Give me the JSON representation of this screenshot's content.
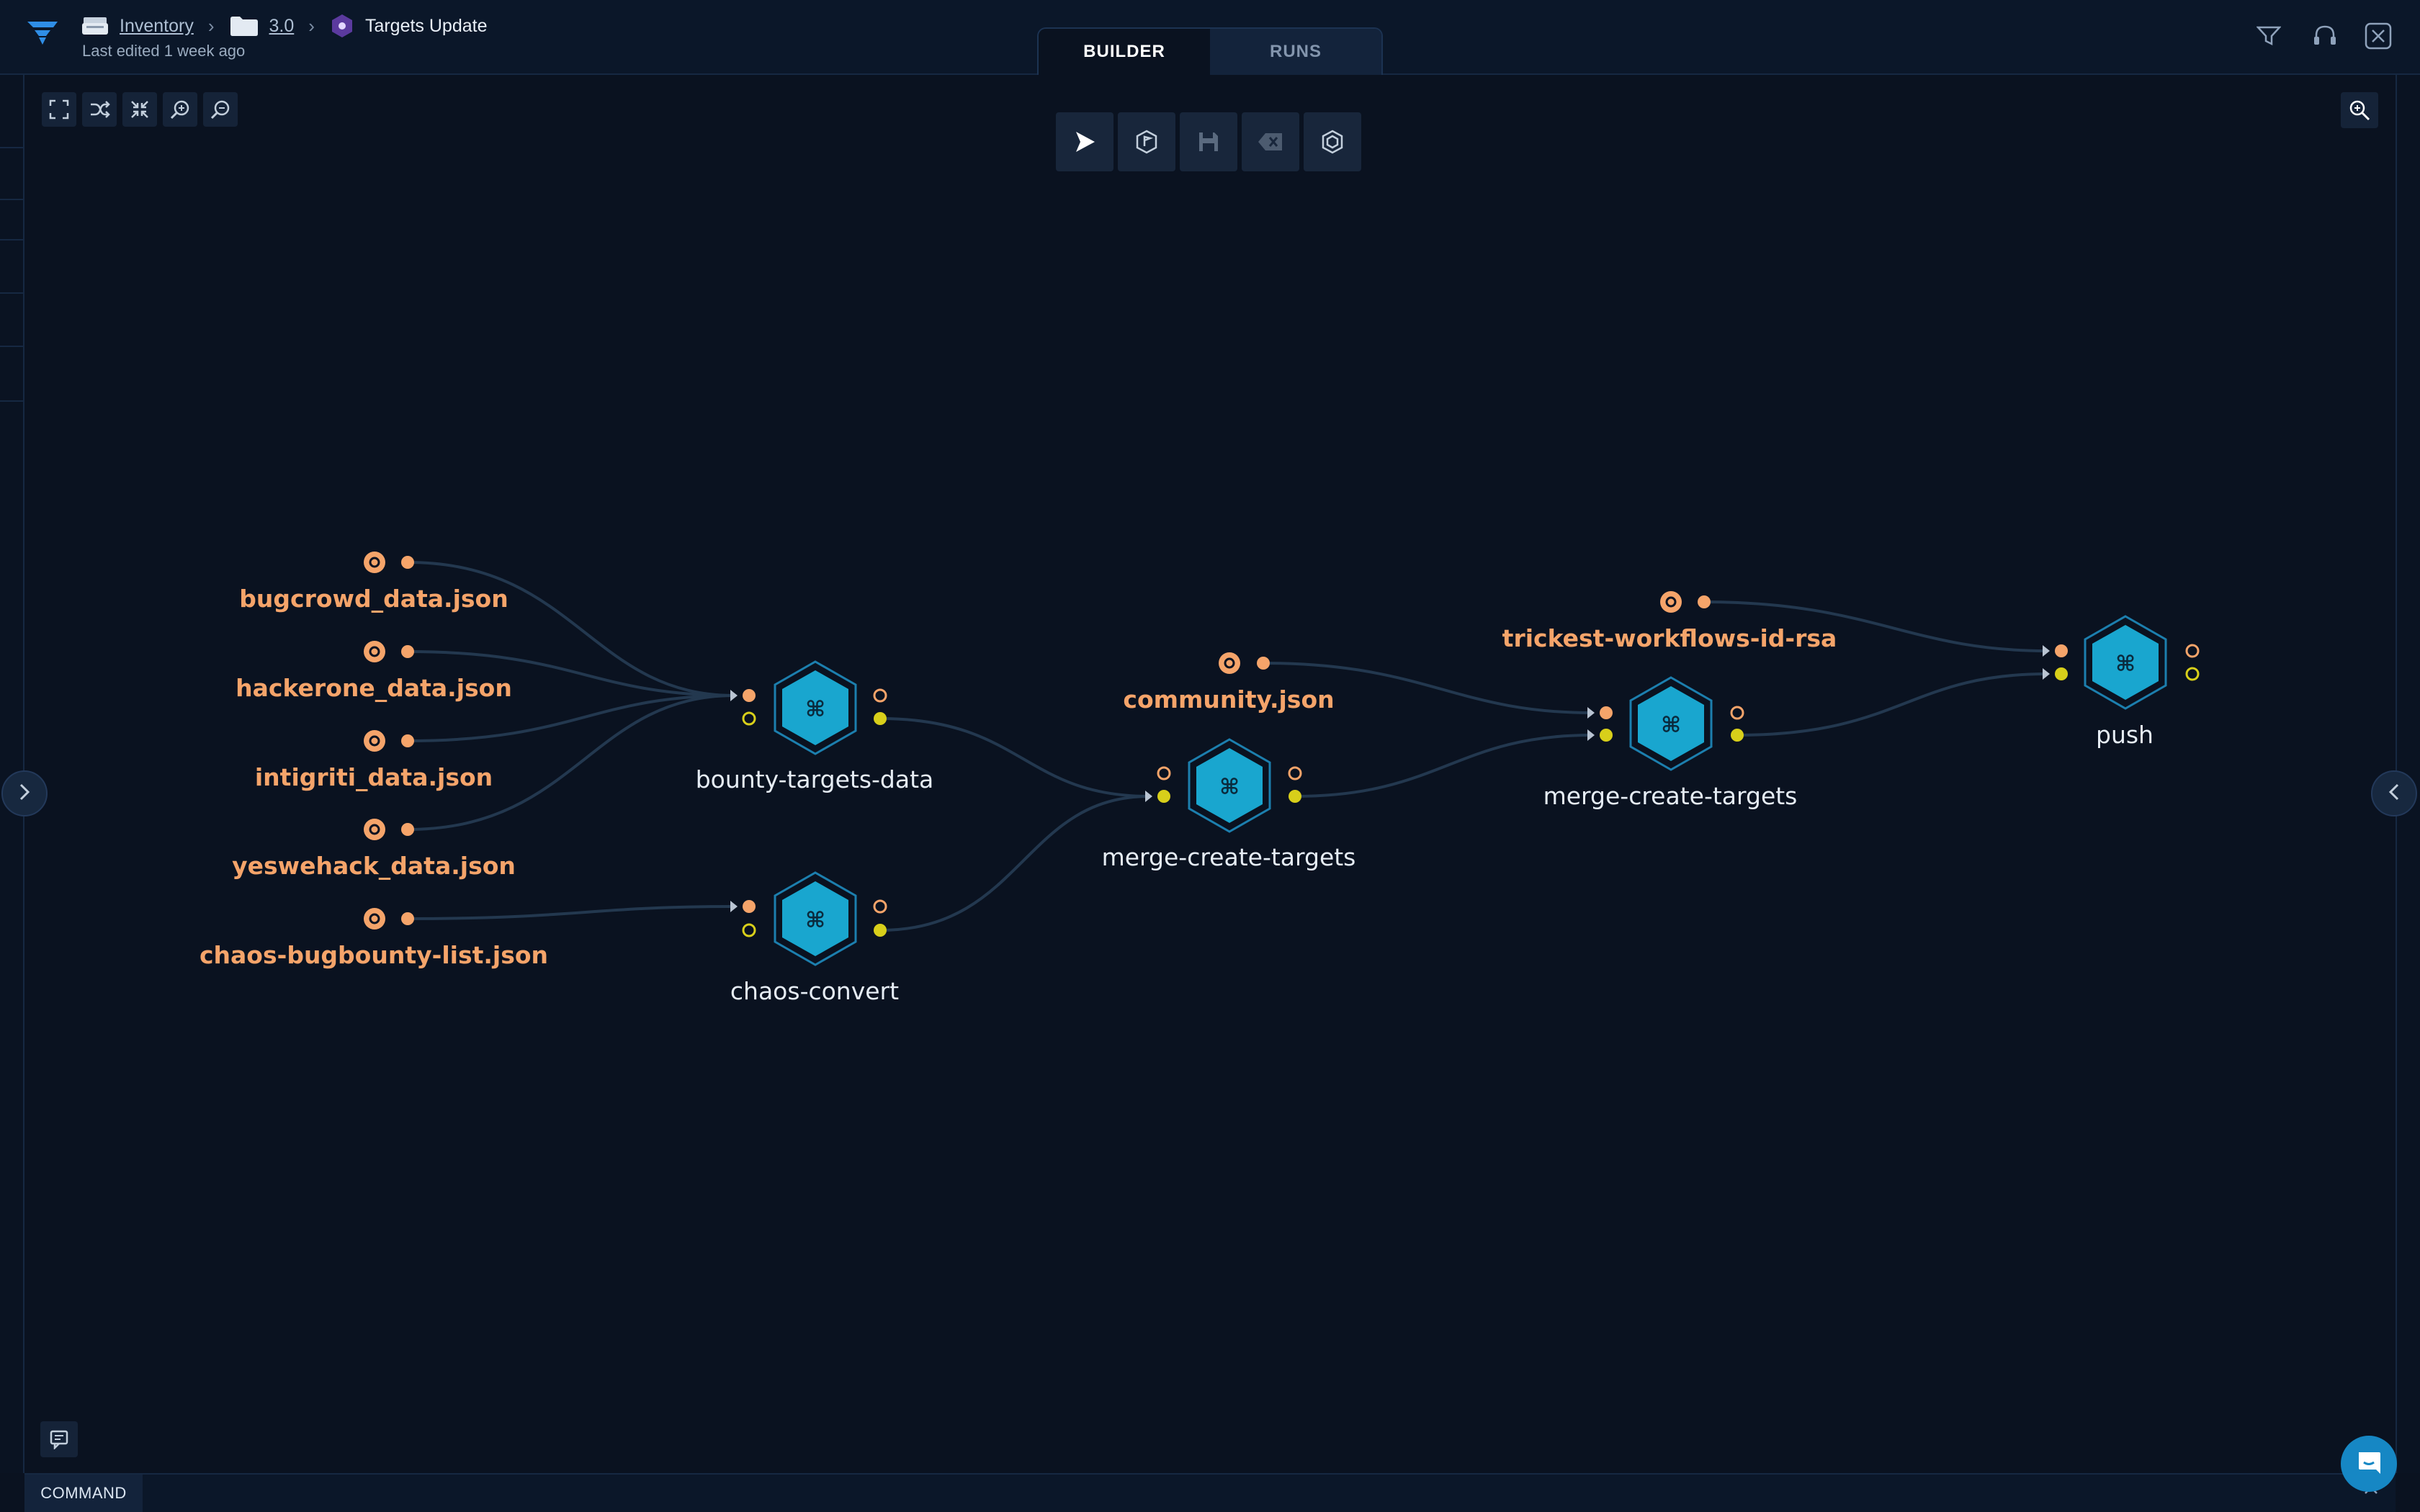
{
  "header": {
    "breadcrumb": {
      "root": "Inventory",
      "folder": "3.0",
      "title": "Targets Update"
    },
    "last_edited": "Last edited 1 week ago",
    "tabs": [
      {
        "label": "BUILDER",
        "active": true
      },
      {
        "label": "RUNS",
        "active": false
      }
    ]
  },
  "canvas": {
    "inputs": [
      {
        "label": "bugcrowd_data.json"
      },
      {
        "label": "hackerone_data.json"
      },
      {
        "label": "intigriti_data.json"
      },
      {
        "label": "yeswehack_data.json"
      },
      {
        "label": "chaos-bugbounty-list.json"
      },
      {
        "label": "community.json"
      },
      {
        "label": "trickest-workflows-id-rsa"
      }
    ],
    "nodes": [
      {
        "label": "bounty-targets-data"
      },
      {
        "label": "chaos-convert"
      },
      {
        "label": "merge-create-targets"
      },
      {
        "label": "merge-create-targets"
      },
      {
        "label": "push"
      }
    ]
  },
  "bottom": {
    "command_label": "COMMAND"
  },
  "colors": {
    "background": "#0a1220",
    "header": "#0b1729",
    "input_orange": "#f5a46a",
    "port_yellow": "#d8cf1a",
    "node_blue": "#19a6cf",
    "edge": "#223650"
  }
}
